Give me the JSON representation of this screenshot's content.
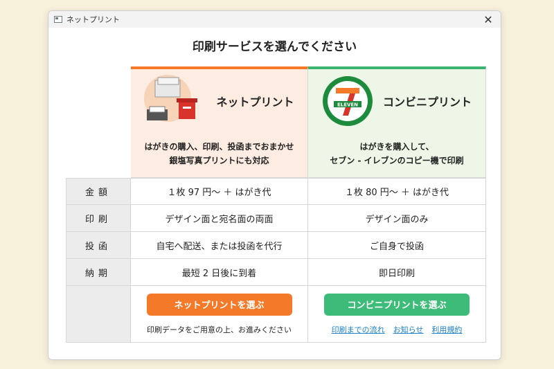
{
  "window": {
    "title": "ネットプリント",
    "close_glyph": "✕"
  },
  "heading": "印刷サービスを選んでください",
  "services": {
    "netprint": {
      "name": "ネットプリント",
      "desc_line1": "はがきの購入、印刷、投函までおまかせ",
      "desc_line2": "銀塩写真プリントにも対応",
      "accent": "#f47a2a",
      "button": "ネットプリントを選ぶ",
      "note": "印刷データをご用意の上、お進みください"
    },
    "conveni": {
      "name": "コンビニプリント",
      "logo_text": "ELEVEN",
      "desc_line1": "はがきを購入して、",
      "desc_line2": "セブン - イレブンのコピー機で印刷",
      "accent": "#3cb371",
      "button": "コンビニプリントを選ぶ",
      "links": [
        "印刷までの流れ",
        "お知らせ",
        "利用規約"
      ]
    }
  },
  "rows": [
    {
      "label": "金額",
      "netprint": "１枚 97 円～ ＋ はがき代",
      "conveni": "１枚 80 円～ ＋ はがき代"
    },
    {
      "label": "印刷",
      "netprint": "デザイン面と宛名面の両面",
      "conveni": "デザイン面のみ"
    },
    {
      "label": "投函",
      "netprint": "自宅へ配送、または投函を代行",
      "conveni": "ご自身で投函"
    },
    {
      "label": "納期",
      "netprint": "最短 2 日後に到着",
      "conveni": "即日印刷"
    }
  ]
}
